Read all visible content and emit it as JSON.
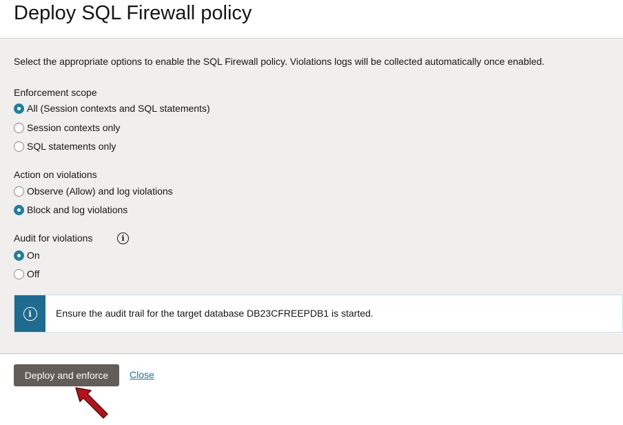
{
  "dialog": {
    "title": "Deploy SQL Firewall policy",
    "intro": "Select the appropriate options to enable the SQL Firewall policy. Violations logs will be collected automatically once enabled."
  },
  "enforcement_scope": {
    "label": "Enforcement scope",
    "options": [
      {
        "label": "All (Session contexts and SQL statements)",
        "selected": true
      },
      {
        "label": "Session contexts only",
        "selected": false
      },
      {
        "label": "SQL statements only",
        "selected": false
      }
    ]
  },
  "action_on_violations": {
    "label": "Action on violations",
    "options": [
      {
        "label": "Observe (Allow) and log violations",
        "selected": false
      },
      {
        "label": "Block and log violations",
        "selected": true
      }
    ]
  },
  "audit_for_violations": {
    "label": "Audit for violations",
    "options": [
      {
        "label": "On",
        "selected": true
      },
      {
        "label": "Off",
        "selected": false
      }
    ]
  },
  "banner": {
    "message": "Ensure the audit trail for the target database DB23CFREEPDB1 is started."
  },
  "footer": {
    "deploy_label": "Deploy and enforce",
    "close_label": "Close"
  },
  "icons": {
    "info": "info-icon",
    "annotation": "red-arrow-annotation"
  },
  "colors": {
    "radio_selected": "#227e9e",
    "banner_accent": "#1f6a8f",
    "primary_button": "#625d58",
    "link": "#1d6f9a",
    "arrow": "#b0141b"
  }
}
